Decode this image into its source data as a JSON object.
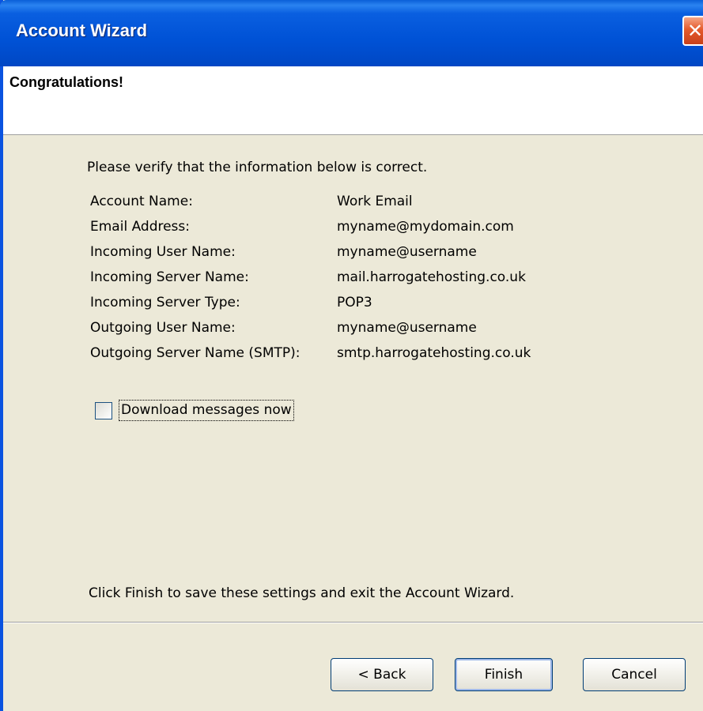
{
  "window": {
    "title": "Account Wizard",
    "close_glyph": "✕"
  },
  "header": {
    "heading": "Congratulations!"
  },
  "content": {
    "intro": "Please verify that the information below is correct.",
    "rows": [
      {
        "label": "Account Name:",
        "value": "Work Email"
      },
      {
        "label": "Email Address:",
        "value": "myname@mydomain.com"
      },
      {
        "label": "Incoming User Name:",
        "value": "myname@username"
      },
      {
        "label": "Incoming Server Name:",
        "value": "mail.harrogatehosting.co.uk"
      },
      {
        "label": "Incoming Server Type:",
        "value": "POP3"
      },
      {
        "label": "Outgoing User Name:",
        "value": "myname@username"
      },
      {
        "label": "Outgoing Server Name (SMTP):",
        "value": "smtp.harrogatehosting.co.uk"
      }
    ],
    "download_checkbox": {
      "label": "Download messages now",
      "checked": false
    },
    "finish_note": "Click Finish to save these settings and exit the Account Wizard."
  },
  "buttons": {
    "back": "< Back",
    "finish": "Finish",
    "cancel": "Cancel"
  },
  "colors": {
    "titlebar": "#0052d6",
    "dialog_background": "#ece9d8",
    "close_button": "#e55a2b"
  }
}
